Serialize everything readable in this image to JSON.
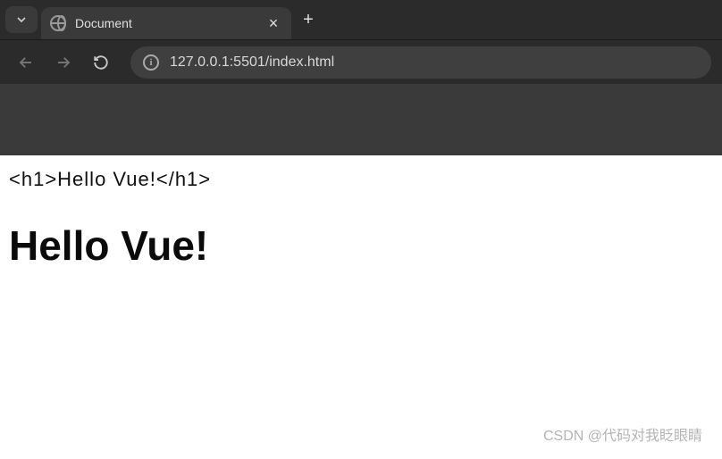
{
  "tab": {
    "title": "Document"
  },
  "address": {
    "url": "127.0.0.1:5501/index.html"
  },
  "page": {
    "raw_markup": "<h1>Hello Vue!</h1>",
    "heading_text": "Hello Vue!"
  },
  "watermark": "CSDN @代码对我眨眼睛"
}
